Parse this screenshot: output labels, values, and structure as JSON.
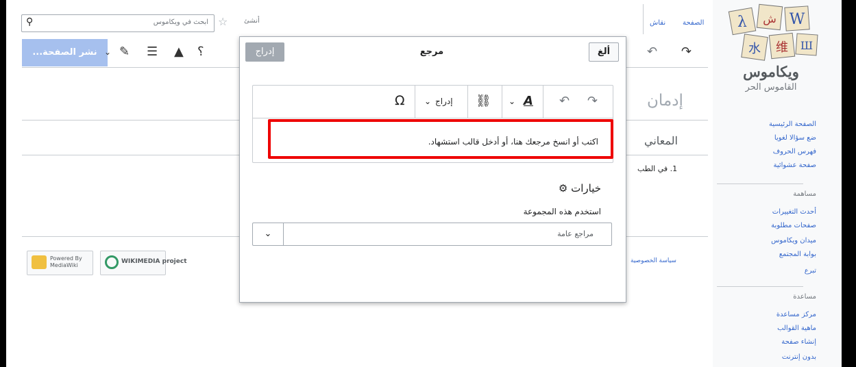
{
  "sidebar": {
    "logo_title": "ويكاموس",
    "logo_subtitle": "القاموس الحر",
    "nav": [
      "الصفحة الرئيسية",
      "ضع سؤالا لغويا",
      "فهرس الحروف",
      "صفحة عشوائية"
    ],
    "contribute_heading": "مساهمة",
    "contribute": [
      "أحدث التغييرات",
      "صفحات مطلوبة",
      "ميدان ويكاموس",
      "بوابة المجتمع",
      "تبرع"
    ],
    "help_heading": "مساعدة",
    "help": [
      "مركز مساعدة",
      "ماهية القوالب",
      "إنشاء صفحة",
      "بدون إنترنت"
    ]
  },
  "tabs": {
    "page": "الصفحة",
    "talk": "نقاش"
  },
  "search": {
    "placeholder": "ابحث في ويكاموس"
  },
  "edit_tab": "أنشئ",
  "toolbar": {
    "publish_label": "نشر الصفحة..."
  },
  "page": {
    "heading": "إدمان",
    "section": "المعاني",
    "item1": "1. في الطب"
  },
  "footer": {
    "privacy": "سياسة الخصوصية",
    "wikimedia_badge": "WIKIMEDIA project",
    "mediawiki_badge": "Powered By MediaWiki"
  },
  "dialog": {
    "title": "مرجع",
    "insert_label": "إدراج",
    "cancel_label": "ألغ",
    "editor_insert_menu": "إدراج",
    "editor_placeholder": "اكتب أو انسخ مرجعك هنا، أو أدخل قالب استشهاد.",
    "options_title": "خيارات",
    "group_label": "استخدم هذه المجموعة",
    "group_value": "مراجع عامة"
  },
  "colors": {
    "highlight": "#ee0000",
    "publish_bg": "#a6c0ee",
    "link": "#3366cc"
  }
}
